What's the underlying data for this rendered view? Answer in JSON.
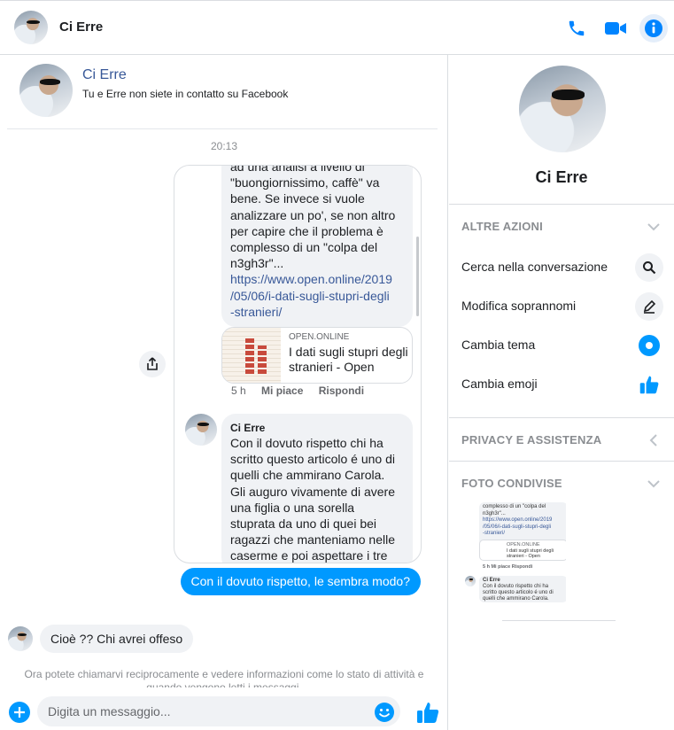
{
  "header": {
    "contact_name": "Ci Erre",
    "icons": [
      "phone-icon",
      "video-camera-icon",
      "info-icon"
    ]
  },
  "chat": {
    "contact_card": {
      "name": "Ci Erre",
      "note": "Tu e Erre non siete in contatto su Facebook"
    },
    "timestamp": "20:13",
    "shared_post": {
      "text_lines": [
        "ad una analisi a livello di",
        "\"buongiornissimo, caffè\" va",
        "bene. Se invece si vuole",
        "analizzare un po', se non altro",
        "per capire che il problema è",
        "complesso di un \"colpa del",
        "n3gh3r\"..."
      ],
      "link_lines": [
        "https://www.open.online/2019",
        "/05/06/i-dati-sugli-stupri-degli",
        "-stranieri/"
      ],
      "link_card": {
        "domain": "OPEN.ONLINE",
        "title": "I dati sugli stupri degli stranieri - Open"
      },
      "actions": {
        "age": "5 h",
        "like": "Mi piace",
        "reply": "Rispondi"
      },
      "comment": {
        "author": "Ci Erre",
        "text_lines": [
          "Con il dovuto rispetto chi ha",
          "scritto questo articolo é uno di",
          "quelli che ammirano Carola.",
          "Gli auguro vivamente di avere",
          "una figlia o una sorella",
          "stuprata da uno di quei bei",
          "ragazzi che manteniamo nelle",
          "caserme e poi aspettare i tre"
        ]
      }
    },
    "sent_message": "Con il dovuto rispetto, le sembra modo?",
    "received_message": "Cioè ?? Chi avrei offeso",
    "notice": "Ora potete chiamarvi reciprocamente e vedere informazioni come lo stato di attività e quando vengono letti i messaggi.",
    "composer": {
      "placeholder": "Digita un messaggio..."
    }
  },
  "info_panel": {
    "name": "Ci Erre",
    "sections": {
      "more_actions": "ALTRE AZIONI",
      "privacy": "PRIVACY E ASSISTENZA",
      "shared_photos": "FOTO CONDIVISE"
    },
    "actions": [
      {
        "label": "Cerca nella conversazione",
        "icon": "search-icon"
      },
      {
        "label": "Modifica soprannomi",
        "icon": "pencil-icon"
      },
      {
        "label": "Cambia tema",
        "icon": "theme-color-icon"
      },
      {
        "label": "Cambia emoji",
        "icon": "thumbs-up-icon"
      }
    ],
    "thumbnail": {
      "post_lines": [
        "complesso di un \"colpa del",
        "n3gh3r\"...",
        "https://www.open.online/2019",
        "/05/06/i-dati-sugli-stupri-degli",
        "-stranieri/"
      ],
      "card_domain": "OPEN.ONLINE",
      "card_title": "I dati sugli stupri degli stranieri - Open",
      "actions": "5 h    Mi piace    Rispondi",
      "comment_author": "Ci Erre",
      "comment_lines": [
        "Con il dovuto rispetto chi ha",
        "scritto questo articolo é uno di",
        "quelli che ammirano Carola."
      ]
    }
  },
  "colors": {
    "accent": "#0099ff",
    "link": "#385898",
    "bubble_gray": "#f0f2f5"
  }
}
